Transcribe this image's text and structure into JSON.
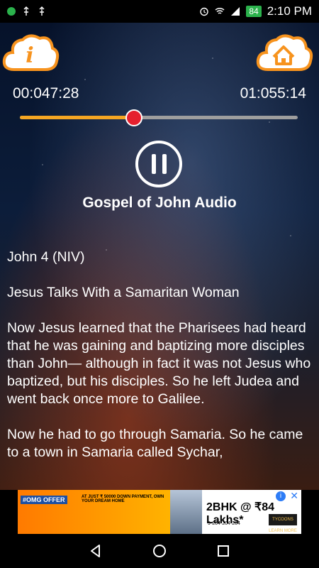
{
  "status_bar": {
    "time": "2:10 PM",
    "battery": "84",
    "icons": [
      "notification-dot-icon",
      "usb-icon",
      "usb-icon",
      "alarm-icon",
      "wifi-icon",
      "signal-icon",
      "battery-icon"
    ]
  },
  "header": {
    "info_icon": "info-icon",
    "home_icon": "home-icon"
  },
  "player": {
    "elapsed": "00:047:28",
    "total": "01:055:14",
    "progress": 0.41,
    "state": "playing",
    "title": "Gospel of John Audio"
  },
  "text": {
    "paragraphs": [
      "John 4 (NIV)",
      "Jesus Talks With a Samaritan Woman",
      "Now Jesus learned that the Pharisees had heard that he was gaining and baptizing more disciples than John— although in fact it was not Jesus who baptized, but his disciples. So he left Judea and went back once more to Galilee.",
      "Now he had to go through Samaria. So he came to a town in Samaria called Sychar,"
    ]
  },
  "ad": {
    "tag": "#OMG OFFER",
    "sub": "AT JUST ₹ 50000 DOWN PAYMENT, OWN YOUR DREAM HOME",
    "bhk": "2BHK @ ₹84 Lakhs*",
    "phone": "9-204-204-204",
    "brand": "TYCOONS LEARN MORE",
    "info": "i",
    "close": "✕"
  },
  "nav": {
    "back": "back-icon",
    "home": "home-circle-icon",
    "recents": "recents-icon"
  },
  "colors": {
    "accent_orange": "#f5a623",
    "thumb_red": "#e5202e",
    "cloud_orange": "#f7931e"
  }
}
